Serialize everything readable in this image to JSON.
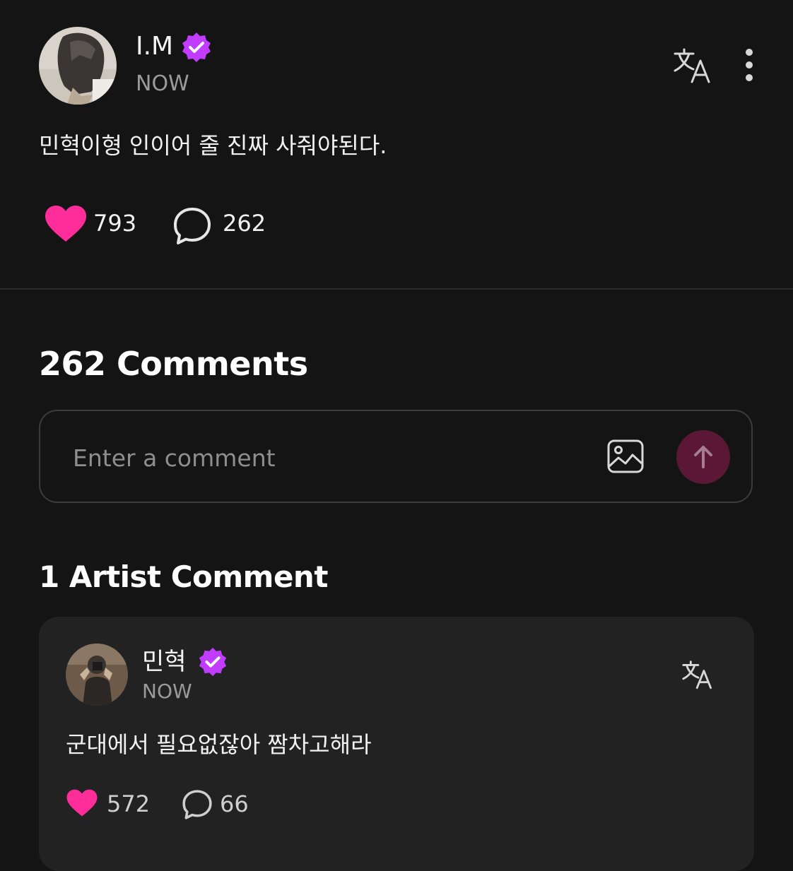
{
  "post": {
    "author": "I.M",
    "time": "NOW",
    "text": "민혁이형 인이어 줄 진짜 사줘야된다.",
    "likes": "793",
    "comments": "262"
  },
  "comments_section": {
    "heading": "262 Comments",
    "input_placeholder": "Enter a comment"
  },
  "artist_comments": {
    "heading": "1 Artist Comment",
    "items": [
      {
        "author": "민혁",
        "time": "NOW",
        "text": "군대에서 필요없잖아 짬차고해라",
        "likes": "572",
        "comments": "66"
      }
    ]
  },
  "icons": {
    "verified": "verified-badge-icon",
    "translate": "translate-icon",
    "more": "more-vertical-icon",
    "like": "heart-icon",
    "comment": "comment-bubble-icon",
    "image": "image-icon",
    "send": "arrow-up-icon"
  },
  "colors": {
    "background": "#141414",
    "card": "#222222",
    "accent_pink": "#ff2d9a",
    "verified_purple": "#c13cff",
    "send_button": "#5a1836",
    "muted_text": "#9a9a9a"
  }
}
